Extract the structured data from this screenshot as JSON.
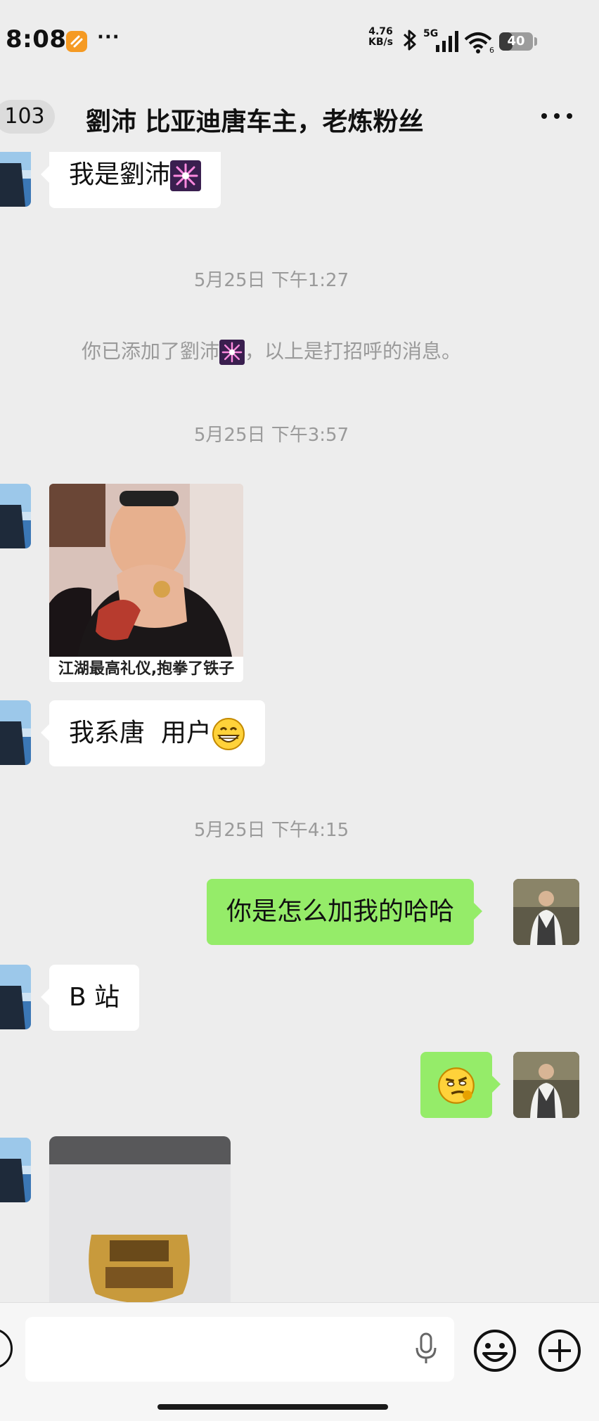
{
  "status_bar": {
    "time": "8:08",
    "network_speed_value": "4.76",
    "network_speed_unit": "KB/s",
    "network_type": "5G",
    "battery_level": "40",
    "battery_fraction": 0.4
  },
  "header": {
    "unread_count": "103",
    "title": "劉沛 比亚迪唐车主，老炼粉丝"
  },
  "messages": {
    "m1_text": "我是劉沛",
    "ts1": "5月25日 下午1:27",
    "system_prefix": "你已添加了劉沛",
    "system_suffix": "，以上是打招呼的消息。",
    "ts2": "5月25日 下午3:57",
    "meme_caption": "江湖最高礼仪,抱拳了铁子",
    "m3_text": "我系唐  用户",
    "ts3": "5月25日 下午4:15",
    "m4_text": "你是怎么加我的哈哈",
    "m5_text": "B 站"
  },
  "icons": {
    "app_notification": "notification-app-icon",
    "bluetooth": "bluetooth-icon",
    "signal": "signal-icon",
    "wifi": "wifi-icon",
    "more": "more-icon",
    "firework_emoji": "firework-emoji",
    "grin_emoji": "grin-emoji",
    "smirk_emoji": "smirk-emoji",
    "mic": "mic-icon",
    "emoji": "emoji-icon",
    "plus": "plus-icon"
  },
  "colors": {
    "chat_background": "#ededed",
    "incoming_bubble": "#ffffff",
    "outgoing_bubble": "#95ec69",
    "timestamp_text": "#9a9a9a"
  }
}
